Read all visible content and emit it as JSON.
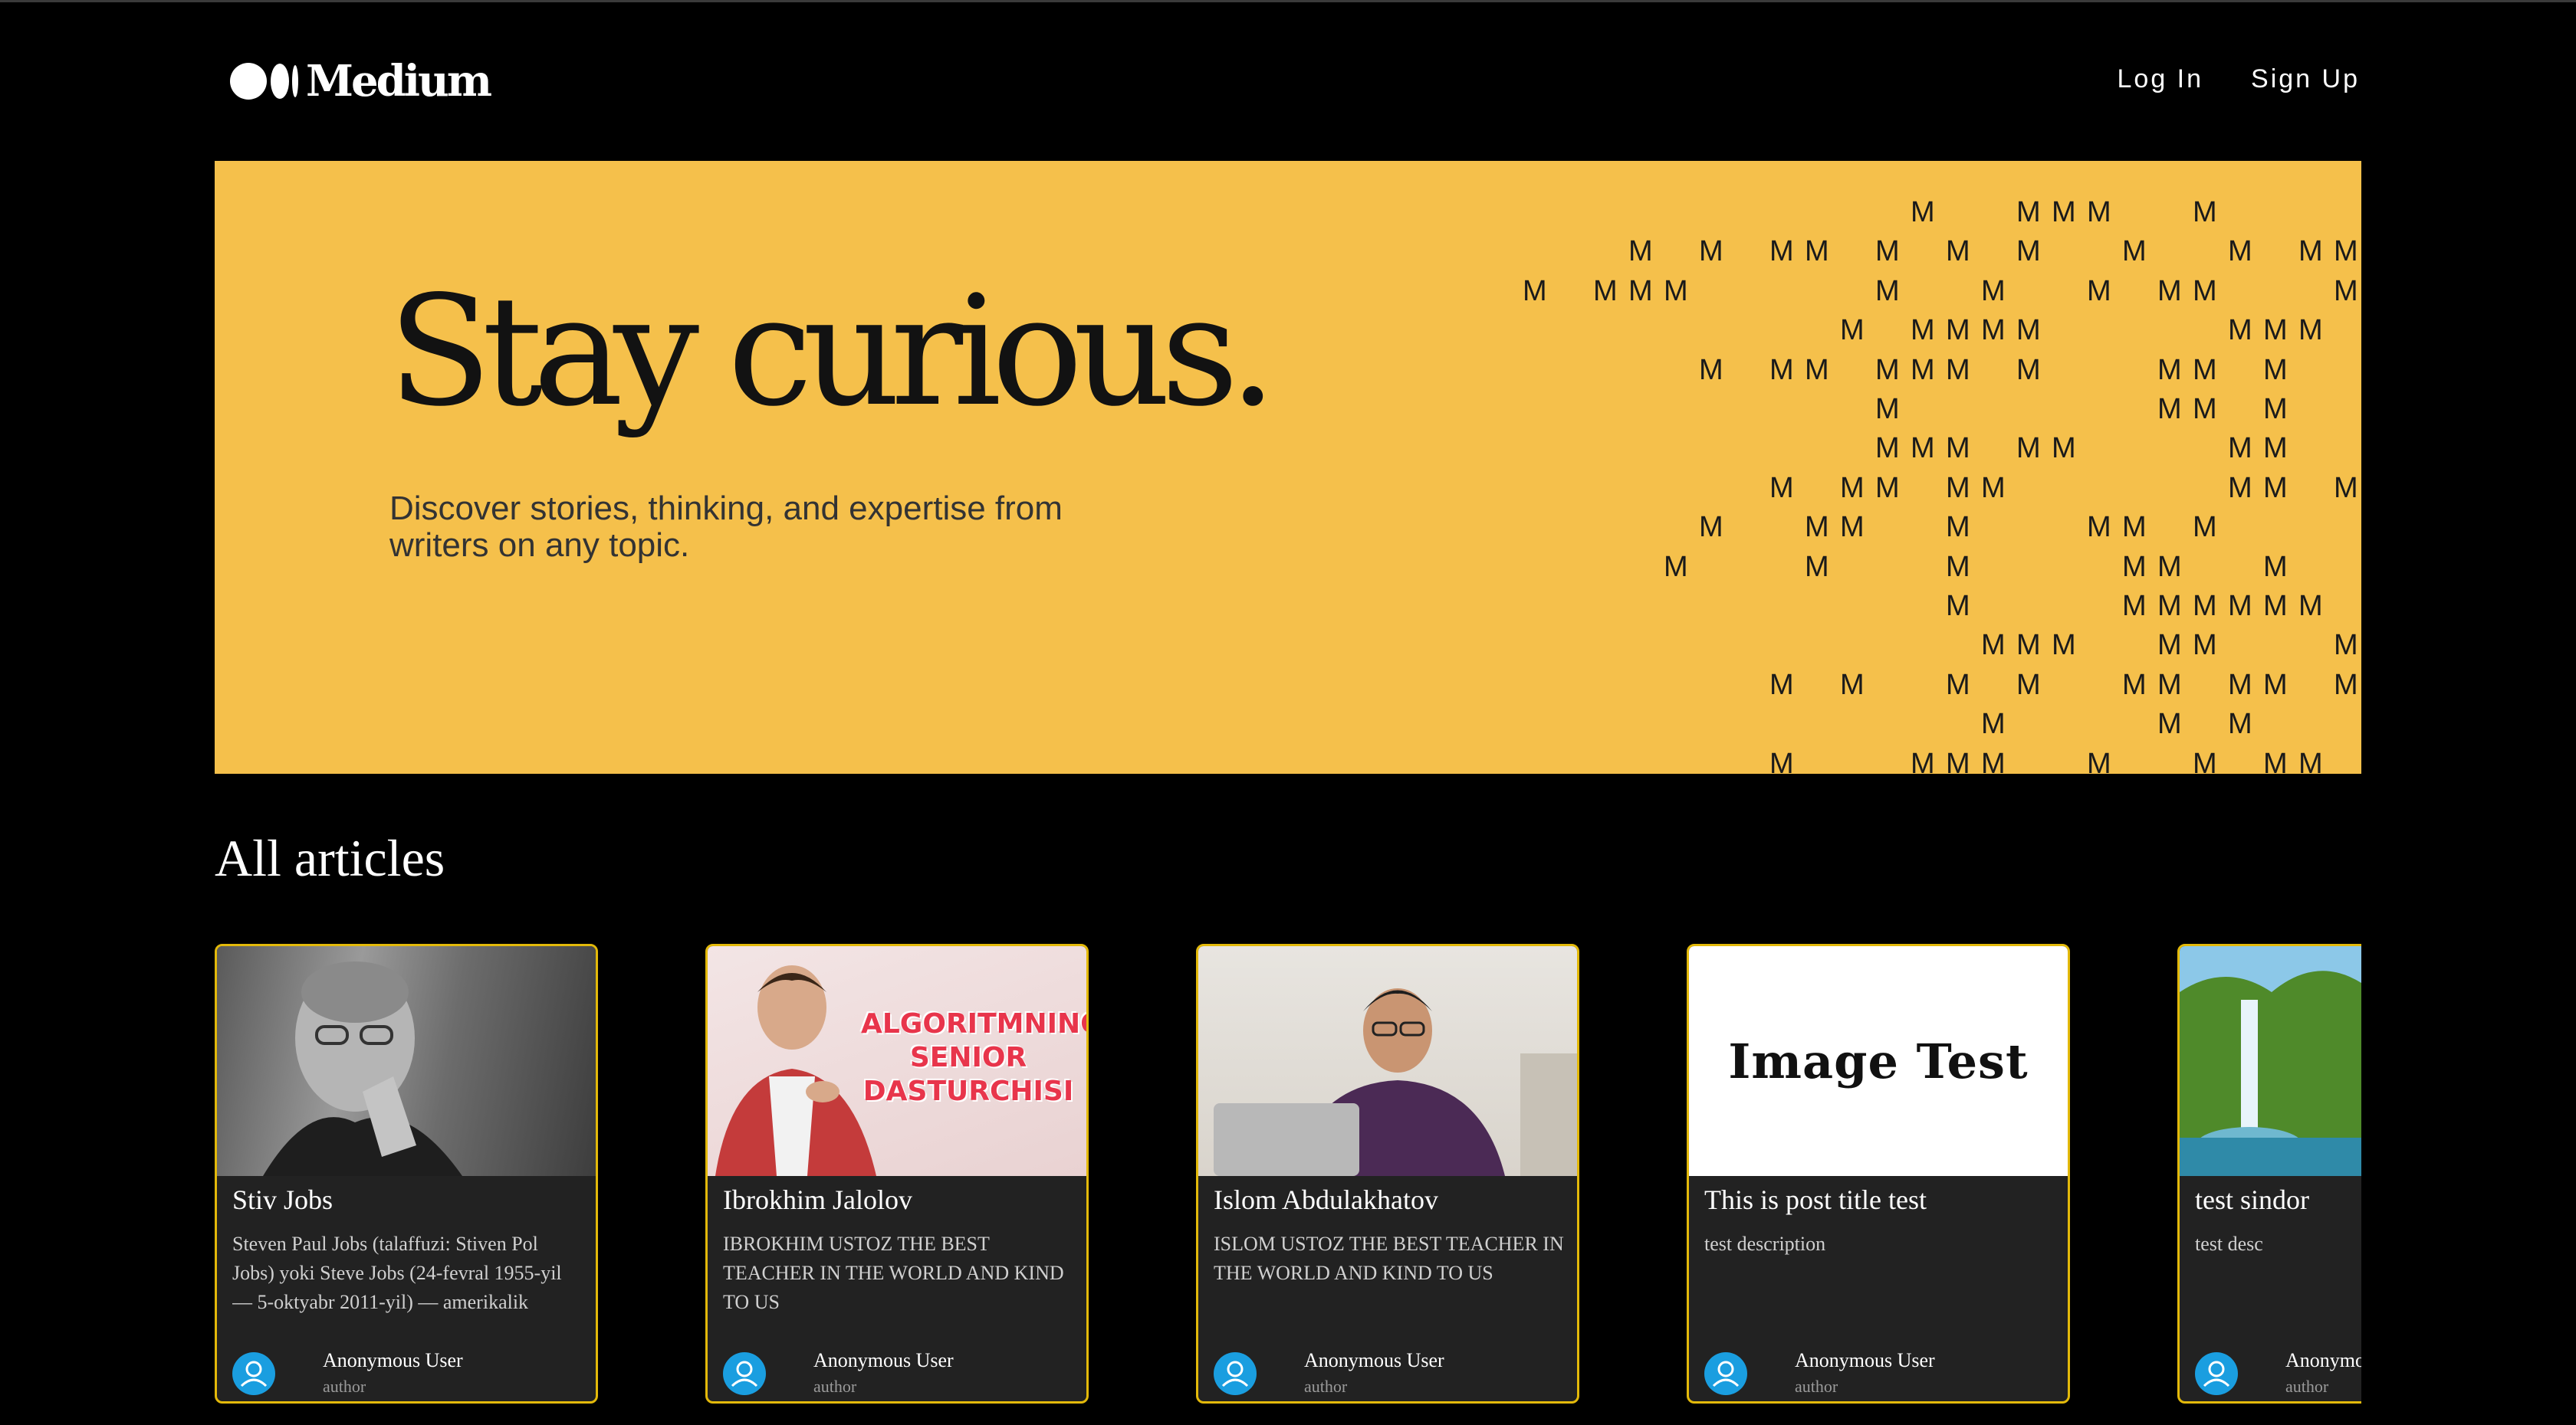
{
  "header": {
    "logo_text": "Medium",
    "login_label": "Log In",
    "signup_label": "Sign Up"
  },
  "hero": {
    "title": "Stay curious.",
    "subtitle": "Discover stories, thinking, and expertise from writers on any topic.",
    "pattern_char": "M",
    "background_color": "#f5c04b"
  },
  "section": {
    "title": "All articles"
  },
  "articles": [
    {
      "title": "Stiv Jobs",
      "description": "Steven Paul Jobs (talaffuzi: Stiven Pol Jobs) yoki Steve Jobs (24-fevral 1955-yil — 5-oktyabr 2011-yil) — amerikalik muhandis va tadbirkor, Apple",
      "author": "Anonymous User",
      "role": "author"
    },
    {
      "title": "Ibrokhim Jalolov",
      "description": "IBROKHIM USTOZ THE BEST TEACHER IN THE WORLD AND KIND TO US",
      "image_text": "ALGORITMNING SENIOR DASTURCHISI",
      "author": "Anonymous User",
      "role": "author"
    },
    {
      "title": "Islom Abdulakhatov",
      "description": "ISLOM USTOZ THE BEST TEACHER IN THE WORLD AND KIND TO US",
      "author": "Anonymous User",
      "role": "author"
    },
    {
      "title": "This is post title test",
      "description": "test description",
      "image_text": "Image Test",
      "author": "Anonymous User",
      "role": "author"
    },
    {
      "title": "test sindor",
      "description": "test desc",
      "author": "Anonymous User",
      "role": "author"
    }
  ],
  "colors": {
    "accent_border": "#e3b90a",
    "card_background": "#222222",
    "avatar": "#1a9ee0"
  }
}
